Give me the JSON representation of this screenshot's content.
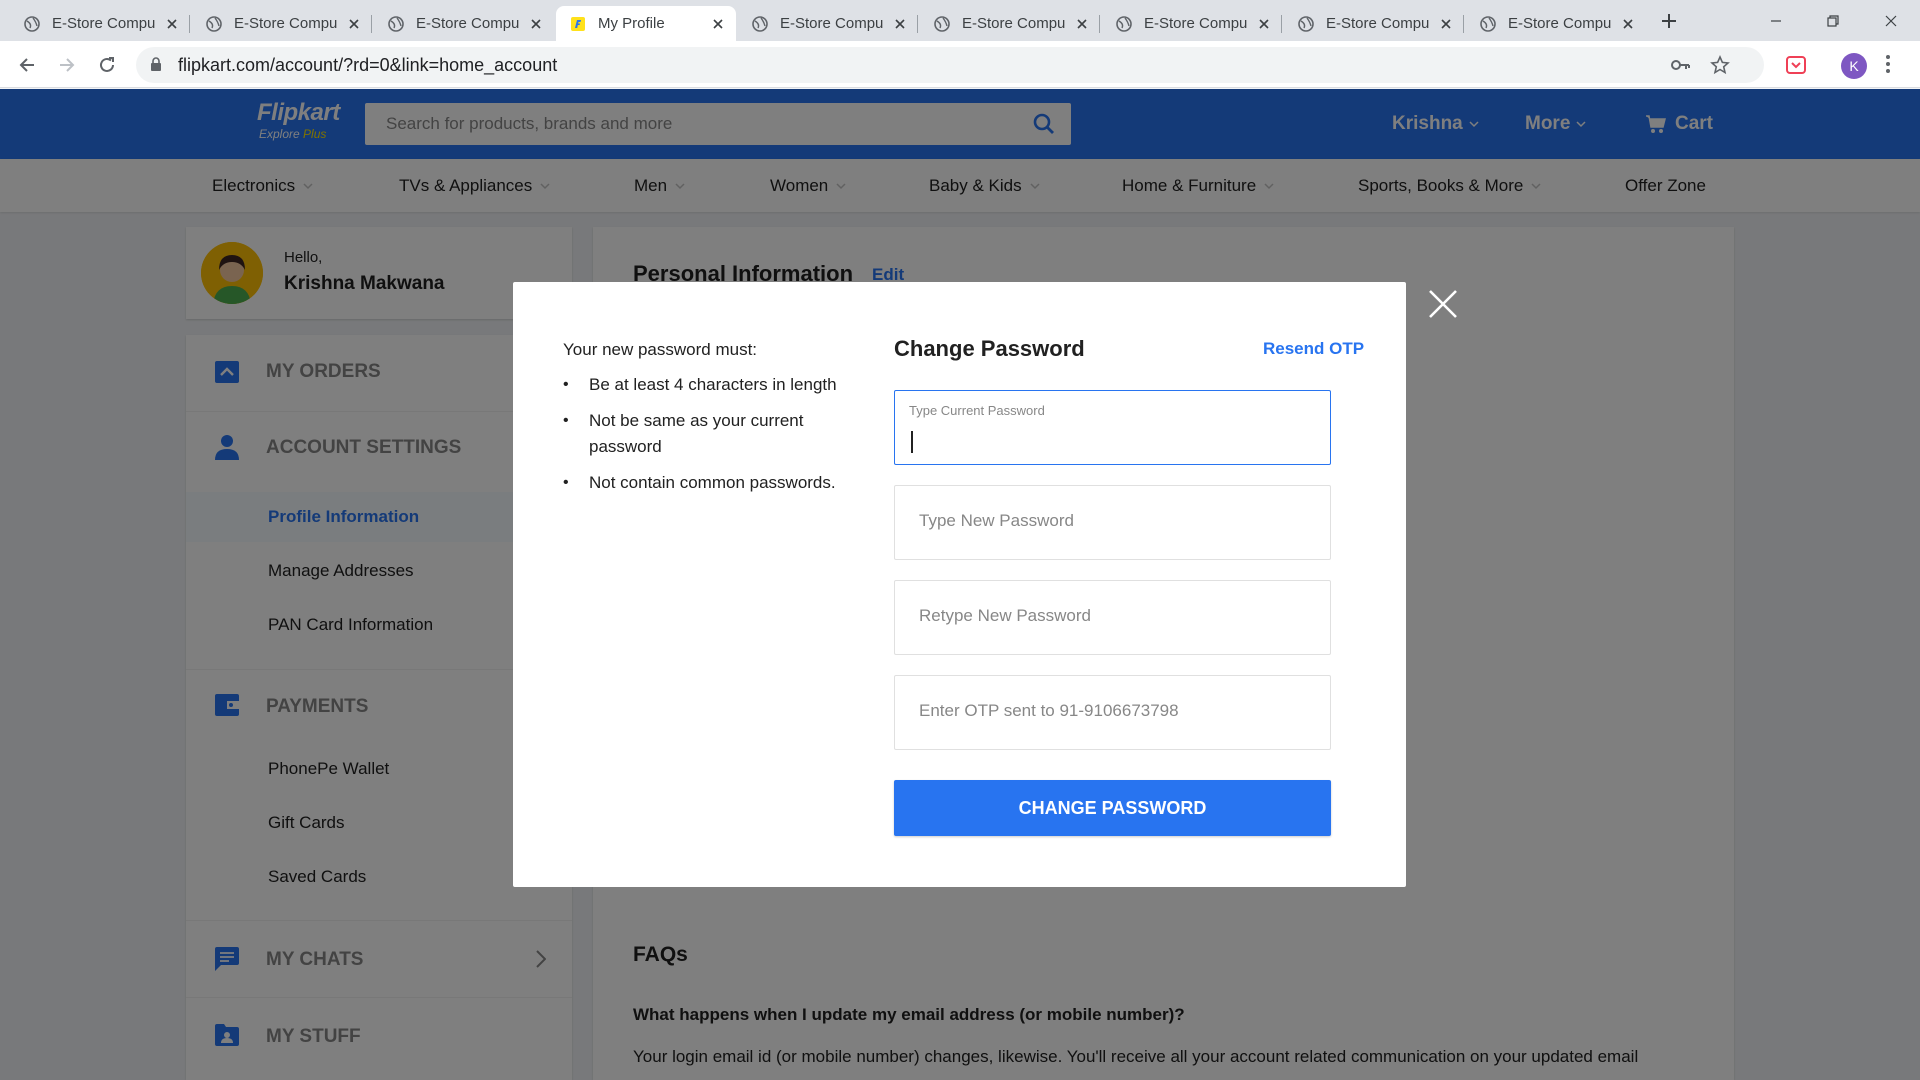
{
  "browser": {
    "tabs": [
      {
        "title": "E-Store Compu",
        "active": false
      },
      {
        "title": "E-Store Compu",
        "active": false
      },
      {
        "title": "E-Store Compu",
        "active": false
      },
      {
        "title": "My Profile",
        "active": true
      },
      {
        "title": "E-Store Compu",
        "active": false
      },
      {
        "title": "E-Store Compu",
        "active": false
      },
      {
        "title": "E-Store Compu",
        "active": false
      },
      {
        "title": "E-Store Compu",
        "active": false
      },
      {
        "title": "E-Store Compu",
        "active": false
      }
    ],
    "url": "flipkart.com/account/?rd=0&link=home_account",
    "profile_initial": "K"
  },
  "header": {
    "logo_main": "Flipkart",
    "logo_sub": "Explore",
    "logo_plus": "Plus",
    "search_placeholder": "Search for products, brands and more",
    "user_label": "Krishna",
    "more_label": "More",
    "cart_label": "Cart"
  },
  "categories": [
    "Electronics",
    "TVs & Appliances",
    "Men",
    "Women",
    "Baby & Kids",
    "Home & Furniture",
    "Sports, Books & More",
    "Offer Zone"
  ],
  "sidebar": {
    "hello": "Hello,",
    "user_name": "Krishna Makwana",
    "my_orders": "MY ORDERS",
    "account_settings": "ACCOUNT SETTINGS",
    "account_items": [
      "Profile Information",
      "Manage Addresses",
      "PAN Card Information"
    ],
    "payments": "PAYMENTS",
    "payment_items": [
      "PhonePe Wallet",
      "Gift Cards",
      "Saved Cards"
    ],
    "my_chats": "MY CHATS",
    "my_stuff": "MY STUFF"
  },
  "main": {
    "personal_info_title": "Personal Information",
    "edit_label": "Edit",
    "faq_title": "FAQs",
    "faq_question": "What happens when I update my email address (or mobile number)?",
    "faq_answer": "Your login email id (or mobile number) changes, likewise. You'll receive all your account related communication on your updated email"
  },
  "modal": {
    "rules_title": "Your new password must:",
    "rules": [
      "Be at least 4 characters in length",
      "Not be same as your current password",
      "Not contain common passwords."
    ],
    "title": "Change Password",
    "resend_otp": "Resend OTP",
    "current_password_label": "Type Current Password",
    "current_password_value": "",
    "new_password_placeholder": "Type New Password",
    "retype_password_placeholder": "Retype New Password",
    "otp_placeholder": "Enter OTP sent to 91-9106673798",
    "submit_label": "CHANGE PASSWORD"
  },
  "colors": {
    "brand_blue": "#2874f0",
    "logo_yellow": "#ffe500",
    "overlay": "rgba(0,0,0,0.5)"
  }
}
